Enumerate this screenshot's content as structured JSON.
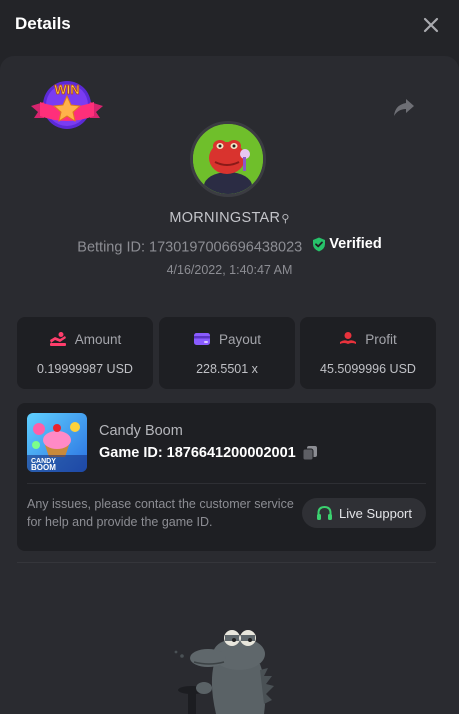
{
  "header": {
    "title": "Details",
    "close_icon": "close-icon"
  },
  "bet": {
    "win_badge_text": "WIN",
    "share_icon": "share-icon",
    "username": "MORNINGSTAR",
    "gender_symbol": "⚲",
    "betting_id_label": "Betting ID:",
    "betting_id": "1730197006696438023",
    "verified_label": "Verified",
    "datetime": "4/16/2022, 1:40:47 AM"
  },
  "stats": [
    {
      "label": "Amount",
      "value": "0.19999987 USD",
      "icon": "amount-icon",
      "color": "#ff3e6c"
    },
    {
      "label": "Payout",
      "value": "228.5501 x",
      "icon": "payout-icon",
      "color": "#8a5cff"
    },
    {
      "label": "Profit",
      "value": "45.5099996 USD",
      "icon": "profit-icon",
      "color": "#e8323c"
    }
  ],
  "game": {
    "name": "Candy Boom",
    "thumb_text": "CANDY BOOM",
    "game_id_label": "Game ID:",
    "game_id": "1876641200002001",
    "support_text": "Any issues, please contact the customer service for help and provide the game ID.",
    "live_support_label": "Live Support"
  },
  "colors": {
    "background": "#232428",
    "panel": "#2a2b30",
    "card": "#1e1f23",
    "verified_green": "#27c26a",
    "support_green": "#3bd16f"
  }
}
